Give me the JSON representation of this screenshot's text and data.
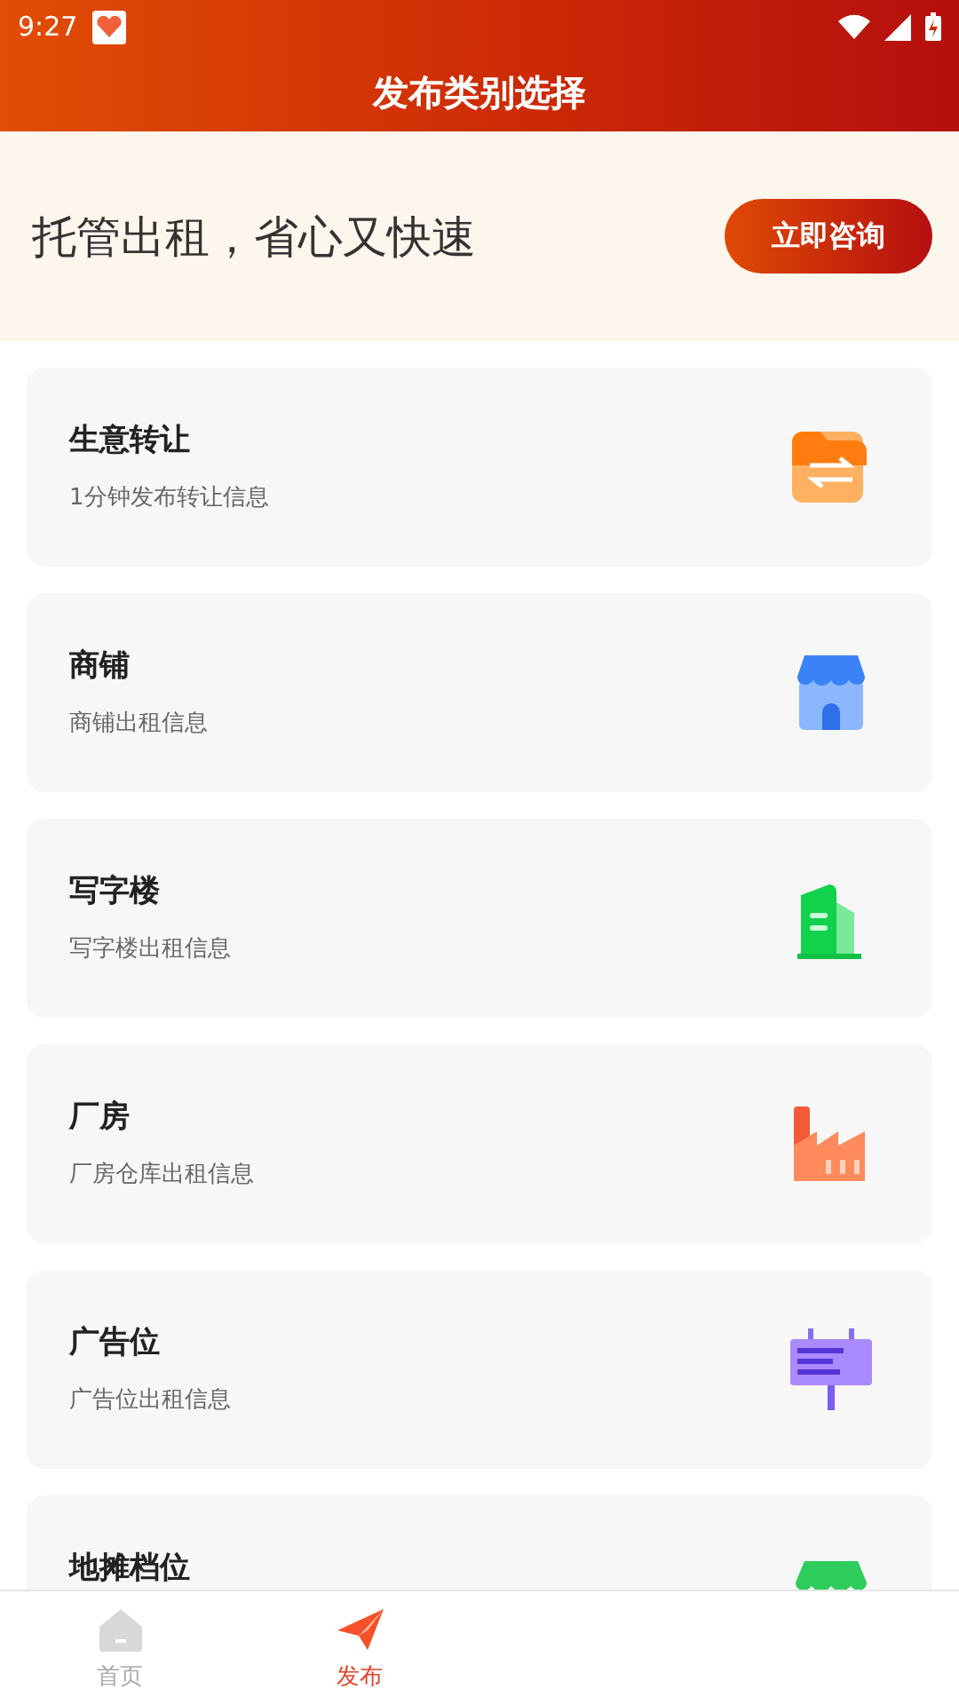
{
  "status_bar": {
    "time": "9:27"
  },
  "header": {
    "title": "发布类别选择"
  },
  "banner": {
    "text": "托管出租，省心又快速",
    "button": "立即咨询"
  },
  "categories": [
    {
      "kind": "transfer",
      "title": "生意转让",
      "subtitle": "1分钟发布转让信息"
    },
    {
      "kind": "shop",
      "title": "商铺",
      "subtitle": "商铺出租信息"
    },
    {
      "kind": "office",
      "title": "写字楼",
      "subtitle": "写字楼出租信息"
    },
    {
      "kind": "factory",
      "title": "厂房",
      "subtitle": "厂房仓库出租信息"
    },
    {
      "kind": "billboard",
      "title": "广告位",
      "subtitle": "广告位出租信息"
    },
    {
      "kind": "stall",
      "title": "地摊档位"
    }
  ],
  "tab_bar": [
    {
      "kind": "home",
      "label": "首页",
      "selected": false
    },
    {
      "kind": "publish",
      "label": "发布",
      "selected": true
    }
  ]
}
